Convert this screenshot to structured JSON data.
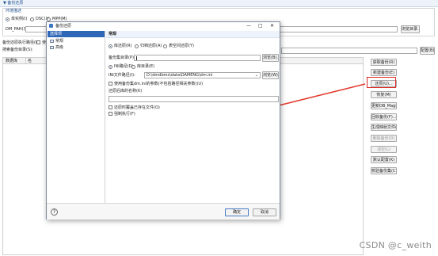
{
  "header": {
    "title": "▼ 备份还原"
  },
  "env": {
    "legend": "环境描述",
    "mode_options": [
      "单实例(I)",
      "DSC(X)",
      "MPP(M)"
    ],
    "dm_path_label": "DM_PAH(I):",
    "dm_path_value": "",
    "browse_label": "浏览目录..."
  },
  "backup_path_label": "备份还原执行路径(L):",
  "default_check_label": "使",
  "search_path_label": "搜索备份目录(S):",
  "config_label": "配置(B)",
  "table": {
    "columns": [
      "数据库",
      "名"
    ]
  },
  "side_buttons": [
    {
      "label": "获取备份(R)",
      "enabled": true
    },
    {
      "label": "新建备份(E)",
      "enabled": true
    },
    {
      "label": "还原(U)...",
      "enabled": true
    },
    {
      "label": "恢复(M)",
      "enabled": true
    },
    {
      "label": "更新DB_Magic(I)",
      "enabled": true
    },
    {
      "label": "回收备份(F)...",
      "enabled": true
    },
    {
      "label": "生成映射文件(D)...",
      "enabled": true
    },
    {
      "label": "删除备份(D)",
      "enabled": false
    },
    {
      "label": "清空(L)",
      "enabled": false
    },
    {
      "label": "默认配置(K)",
      "enabled": true
    },
    {
      "label": "校验备份集(C)",
      "enabled": true
    }
  ],
  "dialog": {
    "title": "备份还原",
    "window_controls": [
      "—",
      "□",
      "✕"
    ],
    "nav": {
      "header": "选择项",
      "items": [
        "常规",
        "高级"
      ]
    },
    "section_title": "常规",
    "restore_types": [
      "库还原(R)",
      "归档还原(A)",
      "表空间还原(Y)"
    ],
    "backup_set_label": "备份集目录(P):",
    "backup_set_value": "",
    "browse_label": "浏览(B)...",
    "ini_options": [
      "INI路径(D)",
      "库目录(E)"
    ],
    "ini_path_label": "INI文件路径(I):",
    "ini_path_value": "D:\\dmdbms\\data\\DAMENG\\dm.ini",
    "browse_label2": "浏览(W)...",
    "checkbox_password": "使用备份集dm.ini的参数(不包括路径相关参数)(U)",
    "password_label": "还原后库的名称(K)",
    "checkbox_overwrite": "还原时覆盖已存在文件(O)",
    "checkbox_force": "强制执行(F)",
    "help": "?",
    "ok_label": "确定",
    "cancel_label": "取消"
  },
  "watermark": "CSDN @c_weith",
  "colors": {
    "arrow": "#e23b2e",
    "highlight_border": "#e02a2a",
    "accent_blue": "#1f4f8f"
  }
}
